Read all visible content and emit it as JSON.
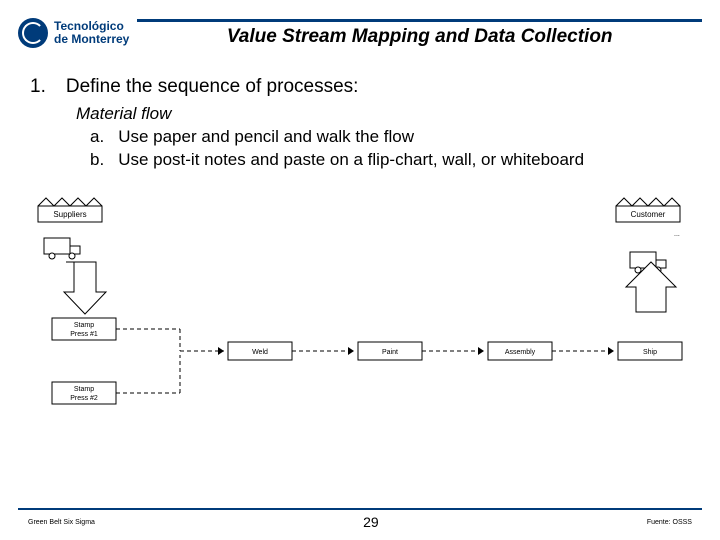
{
  "logo": {
    "line1": "Tecnológico",
    "line2": "de Monterrey"
  },
  "title": "Value Stream Mapping and Data Collection",
  "list": {
    "num": "1.",
    "text": "Define the sequence of processes:",
    "subheading": "Material flow",
    "items": [
      {
        "mark": "a.",
        "text": "Use paper and pencil and walk the flow"
      },
      {
        "mark": "b.",
        "text": "Use post-it notes and paste on a flip-chart, wall, or whiteboard"
      }
    ]
  },
  "diagram": {
    "suppliers": "Suppliers",
    "customer": "Customer",
    "stamp1": "Stamp\nPress #1",
    "stamp2": "Stamp\nPress #2",
    "weld": "Weld",
    "paint": "Paint",
    "assembly": "Assembly",
    "ship": "Ship"
  },
  "footer": {
    "left": "Green Belt Six Sigma",
    "page": "29",
    "right": "Fuente: OSSS"
  }
}
